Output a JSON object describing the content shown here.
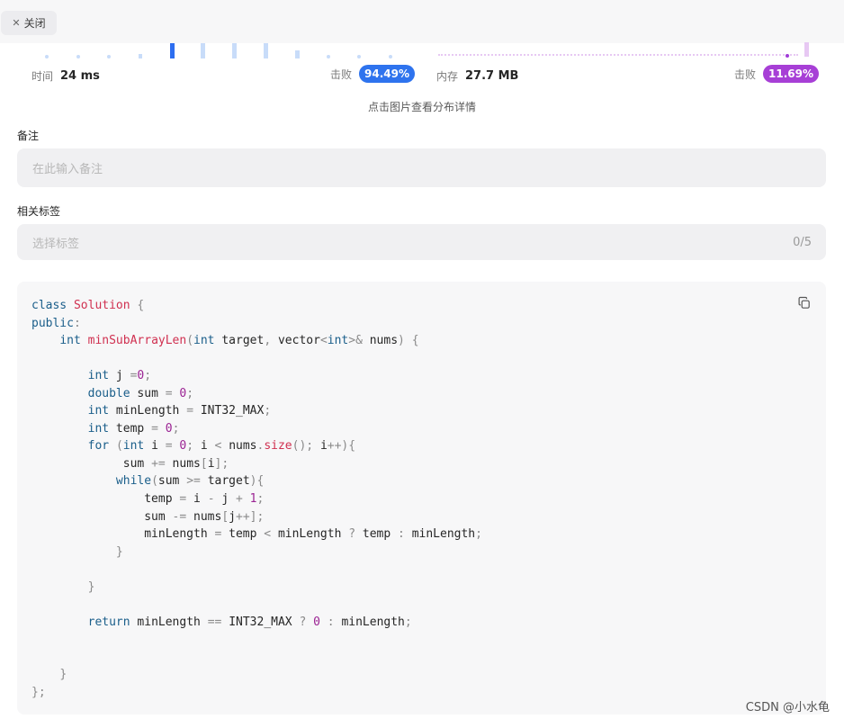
{
  "topbar": {
    "close_label": "关闭"
  },
  "stats": {
    "time_label": "时间",
    "time_value": "24 ms",
    "time_beat_label": "击败",
    "time_beat_pct": "94.49%",
    "memory_label": "内存",
    "memory_value": "27.7 MB",
    "memory_beat_label": "击败",
    "memory_beat_pct": "11.69%",
    "detail_link": "点击图片查看分布详情"
  },
  "colors": {
    "time_accent": "#2e73ee",
    "memory_accent": "#a73fd6"
  },
  "notes": {
    "label": "备注",
    "placeholder": "在此输入备注"
  },
  "tags": {
    "label": "相关标签",
    "placeholder": "选择标签",
    "counter": "0/5"
  },
  "code": {
    "copy_icon": "copy-icon",
    "lines": [
      [
        [
          "k",
          "class "
        ],
        [
          "f",
          "Solution"
        ],
        [
          "p",
          " {"
        ]
      ],
      [
        [
          "k",
          "public"
        ],
        [
          "p",
          ":"
        ]
      ],
      [
        [
          "t",
          "    "
        ],
        [
          "k",
          "int "
        ],
        [
          "f",
          "minSubArrayLen"
        ],
        [
          "p",
          "("
        ],
        [
          "k",
          "int"
        ],
        [
          "t",
          " target"
        ],
        [
          "p",
          ", "
        ],
        [
          "t",
          "vector"
        ],
        [
          "p",
          "<"
        ],
        [
          "k",
          "int"
        ],
        [
          "p",
          ">&"
        ],
        [
          "t",
          " nums"
        ],
        [
          "p",
          ") {"
        ]
      ],
      [],
      [
        [
          "t",
          "        "
        ],
        [
          "k",
          "int"
        ],
        [
          "t",
          " j "
        ],
        [
          "p",
          "="
        ],
        [
          "n",
          "0"
        ],
        [
          "p",
          ";"
        ]
      ],
      [
        [
          "t",
          "        "
        ],
        [
          "k",
          "double"
        ],
        [
          "t",
          " sum "
        ],
        [
          "p",
          "= "
        ],
        [
          "n",
          "0"
        ],
        [
          "p",
          ";"
        ]
      ],
      [
        [
          "t",
          "        "
        ],
        [
          "k",
          "int"
        ],
        [
          "t",
          " minLength "
        ],
        [
          "p",
          "= "
        ],
        [
          "t",
          "INT32_MAX"
        ],
        [
          "p",
          ";"
        ]
      ],
      [
        [
          "t",
          "        "
        ],
        [
          "k",
          "int"
        ],
        [
          "t",
          " temp "
        ],
        [
          "p",
          "= "
        ],
        [
          "n",
          "0"
        ],
        [
          "p",
          ";"
        ]
      ],
      [
        [
          "t",
          "        "
        ],
        [
          "k",
          "for "
        ],
        [
          "p",
          "("
        ],
        [
          "k",
          "int"
        ],
        [
          "t",
          " i "
        ],
        [
          "p",
          "= "
        ],
        [
          "n",
          "0"
        ],
        [
          "p",
          "; "
        ],
        [
          "t",
          "i "
        ],
        [
          "p",
          "< "
        ],
        [
          "t",
          "nums"
        ],
        [
          "p",
          "."
        ],
        [
          "f",
          "size"
        ],
        [
          "p",
          "(); "
        ],
        [
          "t",
          "i"
        ],
        [
          "p",
          "++){"
        ]
      ],
      [
        [
          "t",
          "             sum "
        ],
        [
          "p",
          "+= "
        ],
        [
          "t",
          "nums"
        ],
        [
          "p",
          "["
        ],
        [
          "t",
          "i"
        ],
        [
          "p",
          "];"
        ]
      ],
      [
        [
          "t",
          "            "
        ],
        [
          "k",
          "while"
        ],
        [
          "p",
          "("
        ],
        [
          "t",
          "sum "
        ],
        [
          "p",
          ">= "
        ],
        [
          "t",
          "target"
        ],
        [
          "p",
          "){"
        ]
      ],
      [
        [
          "t",
          "                temp "
        ],
        [
          "p",
          "= "
        ],
        [
          "t",
          "i "
        ],
        [
          "p",
          "- "
        ],
        [
          "t",
          "j "
        ],
        [
          "p",
          "+ "
        ],
        [
          "n",
          "1"
        ],
        [
          "p",
          ";"
        ]
      ],
      [
        [
          "t",
          "                sum "
        ],
        [
          "p",
          "-= "
        ],
        [
          "t",
          "nums"
        ],
        [
          "p",
          "["
        ],
        [
          "t",
          "j"
        ],
        [
          "p",
          "++];"
        ]
      ],
      [
        [
          "t",
          "                minLength "
        ],
        [
          "p",
          "= "
        ],
        [
          "t",
          "temp "
        ],
        [
          "p",
          "< "
        ],
        [
          "t",
          "minLength "
        ],
        [
          "p",
          "? "
        ],
        [
          "t",
          "temp "
        ],
        [
          "p",
          ": "
        ],
        [
          "t",
          "minLength"
        ],
        [
          "p",
          ";"
        ]
      ],
      [
        [
          "t",
          "            "
        ],
        [
          "p",
          "}"
        ]
      ],
      [],
      [
        [
          "t",
          "        "
        ],
        [
          "p",
          "}"
        ]
      ],
      [],
      [
        [
          "t",
          "        "
        ],
        [
          "k",
          "return "
        ],
        [
          "t",
          "minLength "
        ],
        [
          "p",
          "== "
        ],
        [
          "t",
          "INT32_MAX "
        ],
        [
          "p",
          "? "
        ],
        [
          "n",
          "0 "
        ],
        [
          "p",
          ": "
        ],
        [
          "t",
          "minLength"
        ],
        [
          "p",
          ";"
        ]
      ],
      [],
      [],
      [
        [
          "t",
          "    "
        ],
        [
          "p",
          "}"
        ]
      ],
      [
        [
          "p",
          "};"
        ]
      ]
    ]
  },
  "watermark": "CSDN @小水龟"
}
